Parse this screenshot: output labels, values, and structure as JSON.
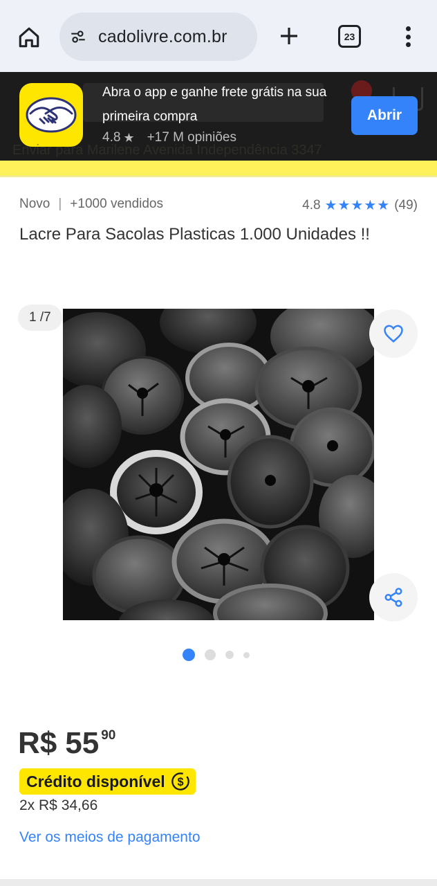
{
  "browser": {
    "url": "cadolivre.com.br",
    "tab_count": "23",
    "icons": [
      "home-icon",
      "site-settings-icon",
      "plus-icon",
      "tabs-icon",
      "more-vert-icon"
    ]
  },
  "app_banner": {
    "title": "Abra o app e ganhe frete grátis na sua primeira compra",
    "rating": "4.8",
    "opinions": "+17 M opiniões",
    "open_label": "Abrir",
    "background_location": "Enviar para Marilene Avenida Independência 3347",
    "cart_badge": "1"
  },
  "product": {
    "condition": "Novo",
    "sold": "+1000 vendidos",
    "rating": "4.8",
    "reviews": "(49)",
    "stars": "★★★★★",
    "title": "Lacre Para Sacolas Plasticas 1.000 Unidades !!"
  },
  "gallery": {
    "counter": "1 /7",
    "total_images": 7,
    "current_index": 1
  },
  "price": {
    "currency": "R$",
    "integer": "55",
    "cents": "90",
    "credit_label": "Crédito disponível",
    "installments": "2x R$ 34,66",
    "payment_link": "Ver os meios de pagamento"
  },
  "colors": {
    "accent_blue": "#3483fa",
    "ml_yellow": "#ffe600",
    "banner_dark": "#1c1c1c"
  }
}
